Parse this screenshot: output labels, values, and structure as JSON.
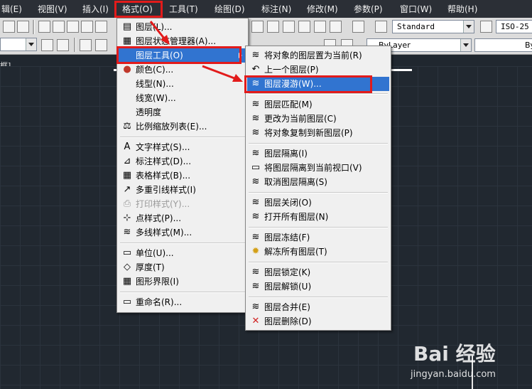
{
  "menubar": {
    "items": [
      {
        "label": "辑(E)"
      },
      {
        "label": "视图(V)"
      },
      {
        "label": "插入(I)"
      },
      {
        "label": "格式(O)"
      },
      {
        "label": "工具(T)"
      },
      {
        "label": "绘图(D)"
      },
      {
        "label": "标注(N)"
      },
      {
        "label": "修改(M)"
      },
      {
        "label": "参数(P)"
      },
      {
        "label": "窗口(W)"
      },
      {
        "label": "帮助(H)"
      }
    ]
  },
  "toolbar": {
    "text_style": "Standard",
    "dim_style": "ISO-25",
    "layer_combo": "ByLayer",
    "linetype_combo": "ByLayer",
    "tab_fragment": "框]"
  },
  "format_menu": {
    "items": [
      {
        "label": "图层(L)...",
        "icon": "layers-icon"
      },
      {
        "label": "图层状态管理器(A)...",
        "icon": "layer-state-icon"
      },
      {
        "label": "图层工具(O)",
        "icon": "",
        "highlighted": true
      },
      {
        "label": "颜色(C)...",
        "icon": "color-wheel-icon"
      },
      {
        "label": "线型(N)...",
        "icon": ""
      },
      {
        "label": "线宽(W)...",
        "icon": ""
      },
      {
        "label": "透明度",
        "icon": ""
      },
      {
        "label": "比例缩放列表(E)...",
        "icon": "scale-list-icon"
      },
      {
        "label": "文字样式(S)...",
        "icon": "text-style-icon"
      },
      {
        "label": "标注样式(D)...",
        "icon": "dim-style-icon"
      },
      {
        "label": "表格样式(B)...",
        "icon": "table-style-icon"
      },
      {
        "label": "多重引线样式(I)",
        "icon": "multileader-icon"
      },
      {
        "label": "打印样式(Y)...",
        "icon": "plot-style-icon",
        "disabled": true
      },
      {
        "label": "点样式(P)...",
        "icon": "point-style-icon"
      },
      {
        "label": "多线样式(M)...",
        "icon": "multiline-style-icon"
      },
      {
        "label": "单位(U)...",
        "icon": "units-icon"
      },
      {
        "label": "厚度(T)",
        "icon": "thickness-icon"
      },
      {
        "label": "图形界限(I)",
        "icon": "limits-icon"
      },
      {
        "label": "重命名(R)...",
        "icon": "rename-icon"
      }
    ]
  },
  "layer_tools_menu": {
    "items": [
      {
        "label": "将对象的图层置为当前(R)",
        "icon": "make-current-icon"
      },
      {
        "label": "上一个图层(P)",
        "icon": "previous-layer-icon"
      },
      {
        "label": "图层漫游(W)...",
        "icon": "layer-walk-icon",
        "highlighted": true
      },
      {
        "label": "图层匹配(M)",
        "icon": "layer-match-icon"
      },
      {
        "label": "更改为当前图层(C)",
        "icon": "change-to-current-icon"
      },
      {
        "label": "将对象复制到新图层(P)",
        "icon": "copy-to-layer-icon"
      },
      {
        "label": "图层隔离(I)",
        "icon": "layer-isolate-icon"
      },
      {
        "label": "将图层隔离到当前视口(V)",
        "icon": "isolate-viewport-icon"
      },
      {
        "label": "取消图层隔离(S)",
        "icon": "unisolate-icon"
      },
      {
        "label": "图层关闭(O)",
        "icon": "layer-off-icon"
      },
      {
        "label": "打开所有图层(N)",
        "icon": "layers-on-icon"
      },
      {
        "label": "图层冻结(F)",
        "icon": "layer-freeze-icon"
      },
      {
        "label": "解冻所有图层(T)",
        "icon": "thaw-all-icon"
      },
      {
        "label": "图层锁定(K)",
        "icon": "layer-lock-icon"
      },
      {
        "label": "图层解锁(U)",
        "icon": "layer-unlock-icon"
      },
      {
        "label": "图层合并(E)",
        "icon": "layer-merge-icon"
      },
      {
        "label": "图层删除(D)",
        "icon": "layer-delete-icon"
      }
    ]
  },
  "watermark": {
    "brand": "Bai 经验",
    "url": "jingyan.baidu.com"
  },
  "colors": {
    "highlight": "#3174d0",
    "annotation_red": "#e21b1b",
    "menubar_bg": "#2b2f36",
    "canvas_bg": "#212830"
  }
}
